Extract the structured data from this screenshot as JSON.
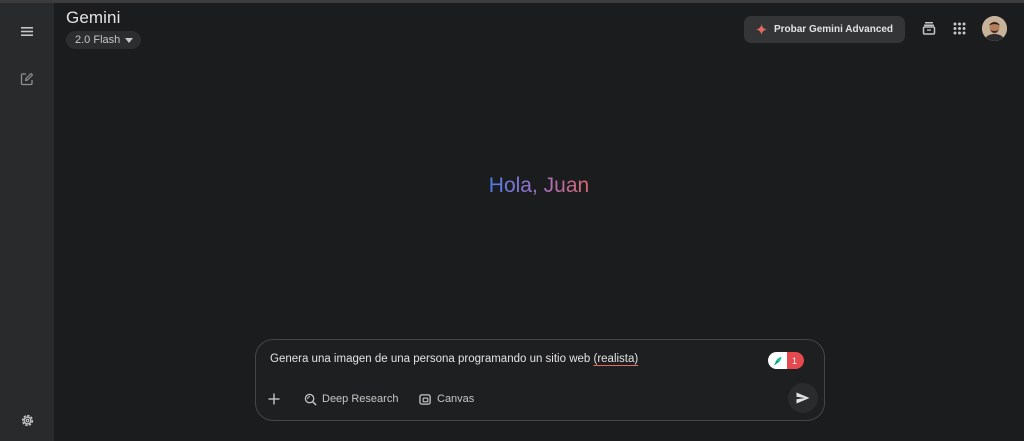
{
  "app": {
    "name": "Gemini",
    "model": "2.0 Flash"
  },
  "header": {
    "upgrade_label": "Probar Gemini Advanced"
  },
  "greeting": "Hola, Juan",
  "composer": {
    "prompt_main": "Genera una imagen de una persona programando un sitio web ",
    "prompt_flagged": "(realista)",
    "issue_count": "1",
    "tools": [
      {
        "label": "Deep Research",
        "icon": "deep-research-icon"
      },
      {
        "label": "Canvas",
        "icon": "canvas-icon"
      }
    ]
  },
  "sidebar": {
    "icons": [
      "menu-icon",
      "new-chat-icon",
      "settings-icon"
    ]
  },
  "colors": {
    "background": "#1b1c1d",
    "sidebar": "#282a2c",
    "greeting_gradient": [
      "#4a7ee6",
      "#9b72cb",
      "#d96570"
    ],
    "badge_red": "#e5484d",
    "sparkle": "#e46962"
  }
}
